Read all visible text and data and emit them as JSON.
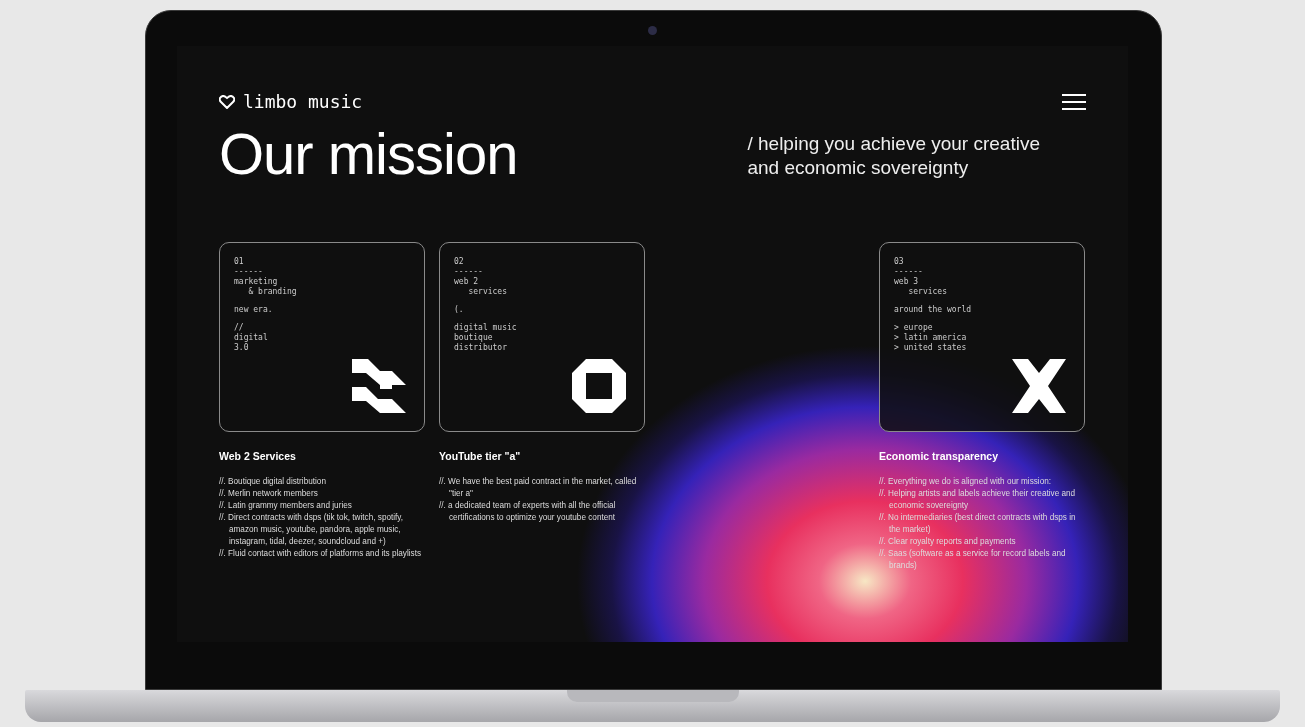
{
  "header": {
    "logo": "limbo music"
  },
  "hero": {
    "title": "Our mission",
    "tagline": "/ helping you achieve your creative\nand economic sovereignty"
  },
  "columns": [
    {
      "card_lines": [
        [
          "01",
          "------",
          "marketing",
          "   & branding"
        ],
        [
          "new era."
        ],
        [
          "//",
          "digital",
          "3.0"
        ]
      ],
      "title": "Web 2 Services",
      "items": [
        "//. Boutique digital distribution",
        "//. Merlin network members",
        "//. Latin grammy members and juries",
        "//. Direct contracts with dsps (tik tok, twitch, spotify, amazon music, youtube, pandora, apple music, instagram, tidal, deezer, soundcloud and +)",
        "//. Fluid contact with editors of platforms and its playlists"
      ]
    },
    {
      "card_lines": [
        [
          "02",
          "------",
          "web 2",
          "   services"
        ],
        [
          "(."
        ],
        [
          "digital music",
          "boutique",
          "distributor"
        ]
      ],
      "title": "YouTube tier \"a\"",
      "items": [
        "//. We have the best paid contract in the market, called \"tier a\"",
        "//. a dedicated team of experts with all the official certifications to optimize your youtube content"
      ]
    },
    {
      "card_lines": [
        [
          "03",
          "------",
          "web 3",
          "   services"
        ],
        [
          "around the world"
        ],
        [
          "> europe",
          "> latin america",
          "> united states"
        ]
      ],
      "title": "Economic transparency",
      "items": [
        "//. Everything we do is aligned with our mission:",
        "//. Helping artists and labels achieve their creative and economic sovereignty",
        "//. No intermediaries (best direct contracts with dsps in the market)",
        "//. Clear royalty reports and payments",
        "//. Saas (software as a service for record labels and brands)"
      ]
    }
  ]
}
